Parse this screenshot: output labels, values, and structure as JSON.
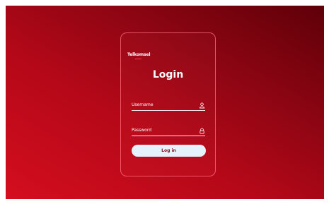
{
  "brand": {
    "name": "Telkomsel"
  },
  "login": {
    "title": "Login",
    "username_label": "Username",
    "password_label": "Password",
    "submit_label": "Log in",
    "username_icon": "user-icon",
    "password_icon": "lock-icon"
  },
  "colors": {
    "background_start": "#d40e1f",
    "background_end": "#5e0008",
    "button": "#e4f3fb",
    "button_text": "#8a1020"
  }
}
